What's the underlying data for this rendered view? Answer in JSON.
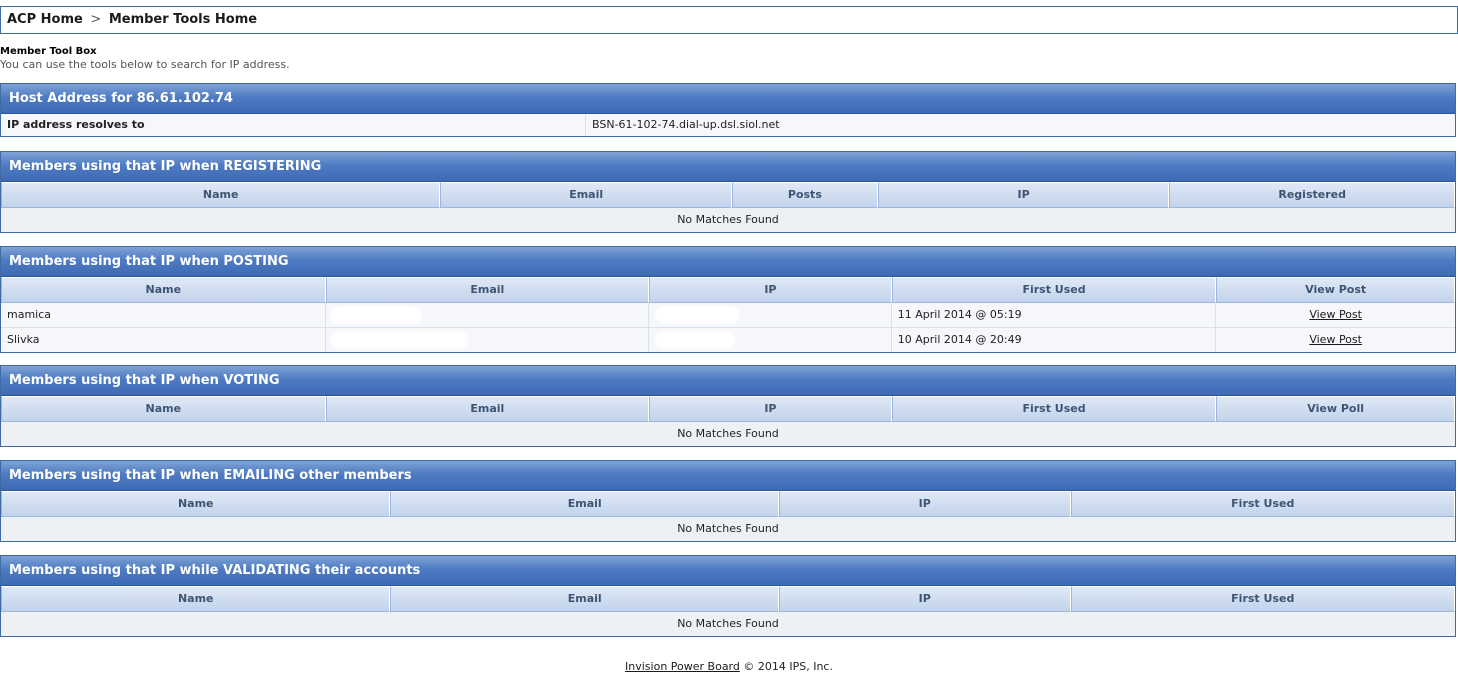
{
  "breadcrumb": {
    "home": "ACP Home",
    "separator": ">",
    "current": "Member Tools Home"
  },
  "toolbox": {
    "title": "Member Tool Box",
    "description": "You can use the tools below to search for IP address."
  },
  "host": {
    "title": "Host Address for 86.61.102.74",
    "label": "IP address resolves to",
    "value": "BSN-61-102-74.dial-up.dsl.siol.net"
  },
  "registering": {
    "title": "Members using that IP when REGISTERING",
    "columns": [
      "Name",
      "Email",
      "Posts",
      "IP",
      "Registered"
    ],
    "empty": "No Matches Found"
  },
  "posting": {
    "title": "Members using that IP when POSTING",
    "columns": [
      "Name",
      "Email",
      "IP",
      "First Used",
      "View Post"
    ],
    "rows": [
      {
        "name": "mamica",
        "first_used": "11 April 2014 @ 05:19",
        "link": "View Post"
      },
      {
        "name": "Slivka",
        "first_used": "10 April 2014 @ 20:49",
        "link": "View Post"
      }
    ]
  },
  "voting": {
    "title": "Members using that IP when VOTING",
    "columns": [
      "Name",
      "Email",
      "IP",
      "First Used",
      "View Poll"
    ],
    "empty": "No Matches Found"
  },
  "emailing": {
    "title": "Members using that IP when EMAILING other members",
    "columns": [
      "Name",
      "Email",
      "IP",
      "First Used"
    ],
    "empty": "No Matches Found"
  },
  "validating": {
    "title": "Members using that IP while VALIDATING their accounts",
    "columns": [
      "Name",
      "Email",
      "IP",
      "First Used"
    ],
    "empty": "No Matches Found"
  },
  "footer": {
    "link": "Invision Power Board",
    "copyright": "© 2014 IPS, Inc."
  }
}
